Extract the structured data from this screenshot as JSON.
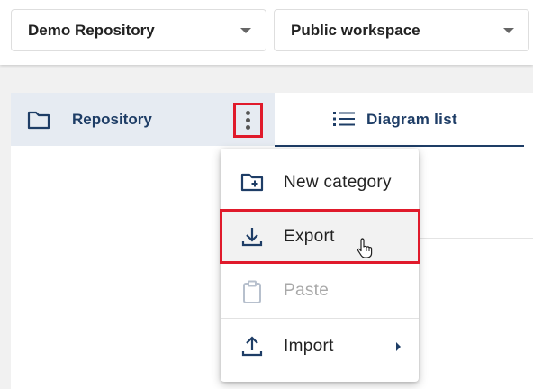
{
  "toolbar": {
    "repository_select": {
      "value": "Demo Repository"
    },
    "workspace_select": {
      "value": "Public workspace"
    }
  },
  "sidebar": {
    "repository_label": "Repository",
    "more_icon": "more-vert-icon"
  },
  "main": {
    "tabs": [
      {
        "label": "Diagram list",
        "icon": "list-icon"
      }
    ]
  },
  "context_menu": {
    "items": [
      {
        "label": "New category",
        "icon": "new-folder-icon",
        "enabled": true
      },
      {
        "label": "Export",
        "icon": "download-icon",
        "enabled": true,
        "hovered": true
      },
      {
        "label": "Paste",
        "icon": "clipboard-icon",
        "enabled": false
      },
      {
        "label": "Import",
        "icon": "upload-icon",
        "enabled": true,
        "has_submenu": true
      }
    ]
  },
  "colors": {
    "accent": "#1e3d66",
    "highlight": "#e01a2b",
    "selected_row": "#e6ebf2",
    "disabled": "#a9a9a9"
  }
}
